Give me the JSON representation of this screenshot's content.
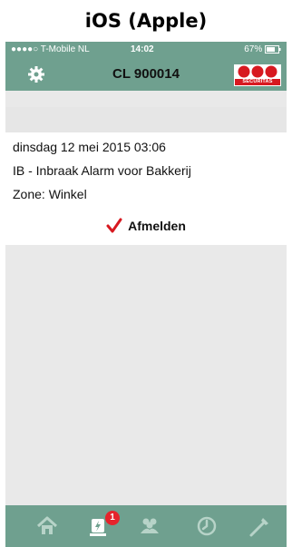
{
  "caption": "iOS (Apple)",
  "statusbar": {
    "carrier": "●●●●○ T-Mobile NL",
    "time": "14:02",
    "battery": "67%"
  },
  "navbar": {
    "title": "CL 900014",
    "logo_text": "SECURITAS",
    "settings_icon": "gear-icon"
  },
  "alarm": {
    "datetime": "dinsdag 12 mei 2015 03:06",
    "description": "IB - Inbraak Alarm voor Bakkerij",
    "zone": "Zone: Winkel",
    "action_label": "Afmelden"
  },
  "tabbar": {
    "items": [
      "home-icon",
      "alarm-icon",
      "people-icon",
      "clock-icon",
      "tool-icon"
    ],
    "alarm_badge": "1"
  },
  "colors": {
    "bar": "#6fa08f",
    "accent_red": "#d71920"
  }
}
